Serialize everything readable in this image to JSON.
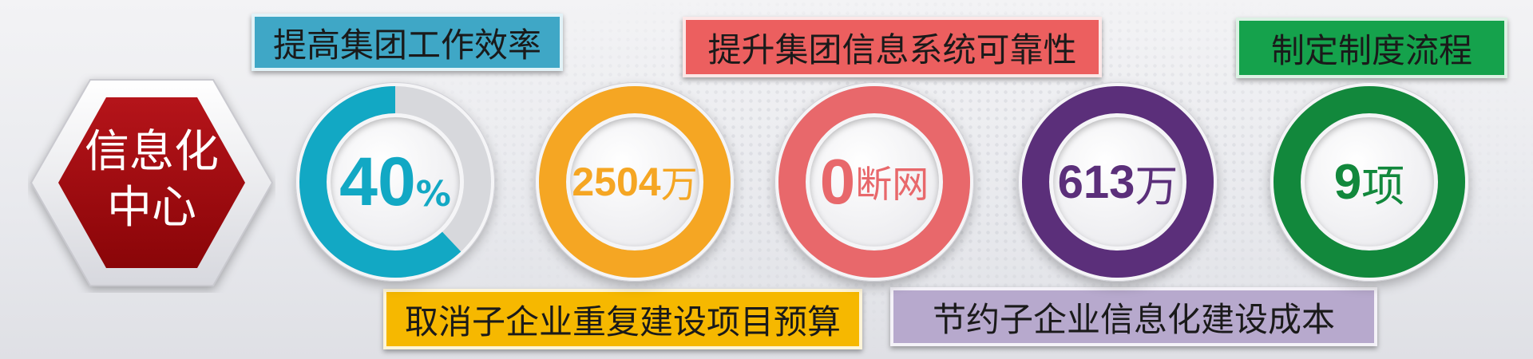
{
  "center": {
    "line1": "信息化",
    "line2": "中心"
  },
  "labels": {
    "efficiency": "提高集团工作效率",
    "reliability": "提升集团信息系统可靠性",
    "process": "制定制度流程",
    "cancel": "取消子企业重复建设项目预算",
    "save": "节约子企业信息化建设成本"
  },
  "metrics": [
    {
      "value": "40",
      "unit": "%",
      "color": "#12a8c4",
      "progress": 0.62
    },
    {
      "value": "2504",
      "unit": "万",
      "color": "#f5a623",
      "progress": 1.0
    },
    {
      "value": "0",
      "unit": "断网",
      "color": "#e8686b",
      "progress": 1.0
    },
    {
      "value": "613",
      "unit": "万",
      "color": "#5b2f7a",
      "progress": 1.0
    },
    {
      "value": "9",
      "unit": "项",
      "color": "#12883c",
      "progress": 1.0
    }
  ],
  "colors": {
    "hex": "#9e0b0f",
    "efficiency": "#3fa7c6",
    "reliability": "#ec5f5f",
    "process": "#15a24c",
    "cancel": "#f6b800",
    "save": "#b7a9cd"
  }
}
